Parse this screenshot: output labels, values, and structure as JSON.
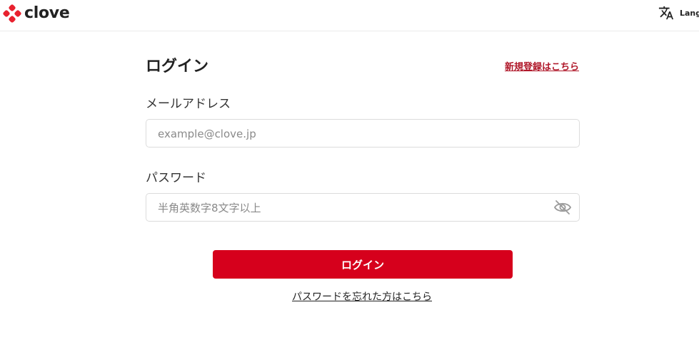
{
  "header": {
    "logo_text": "clove",
    "language_label": "Lang",
    "language_icon": "translate-icon",
    "brand_color": "#e8212e"
  },
  "form": {
    "title": "ログイン",
    "register_link": "新規登録はこちら",
    "email": {
      "label": "メールアドレス",
      "placeholder": "example@clove.jp",
      "value": ""
    },
    "password": {
      "label": "パスワード",
      "placeholder": "半角英数字8文字以上",
      "value": "",
      "toggle_icon": "eye-off-icon"
    },
    "submit_label": "ログイン",
    "forgot_link": "パスワードを忘れた方はこちら"
  },
  "colors": {
    "accent": "#d6001c",
    "link": "#b0182a"
  }
}
